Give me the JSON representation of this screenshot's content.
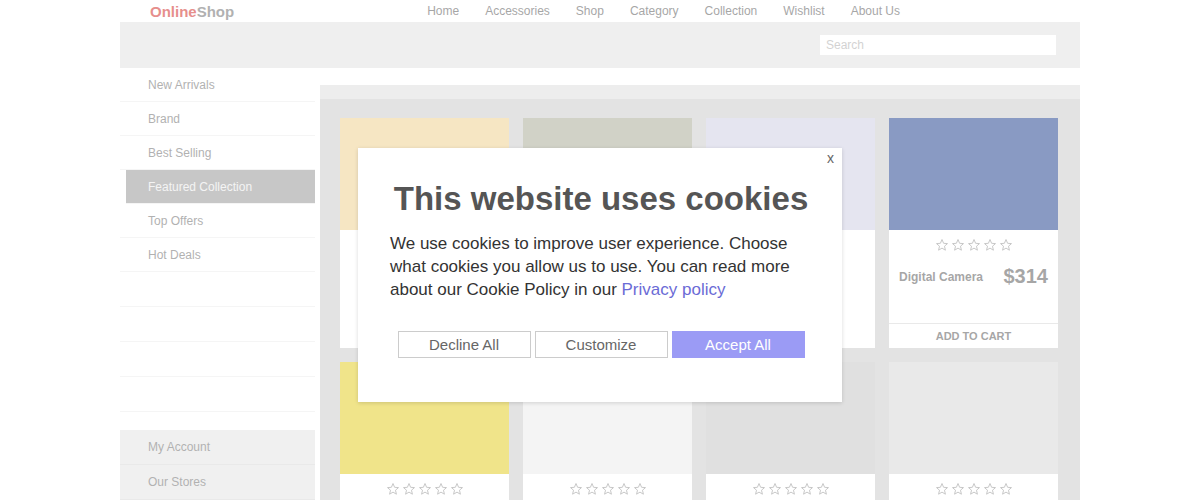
{
  "header": {
    "logo_accent": "Online",
    "logo_rest": "Shop",
    "nav": [
      "Home",
      "Accessories",
      "Shop",
      "Category",
      "Collection",
      "Wishlist",
      "About Us"
    ],
    "search": {
      "placeholder": "Search"
    }
  },
  "sidebar": {
    "items": [
      {
        "label": "New Arrivals",
        "selected": false
      },
      {
        "label": "Brand",
        "selected": false
      },
      {
        "label": "Best Selling",
        "selected": false
      },
      {
        "label": "Featured Collection",
        "selected": true
      },
      {
        "label": "Top Offers",
        "selected": false
      },
      {
        "label": "Hot Deals",
        "selected": false
      }
    ],
    "bottom_items": [
      "My Account",
      "Our Stores"
    ]
  },
  "products": [
    {
      "stars": 0
    },
    {
      "stars": 0
    },
    {
      "stars": 0
    },
    {
      "stars": 0,
      "name": "Digital Camera",
      "price": "$314",
      "button": "ADD TO CART"
    },
    {
      "stars": 0
    },
    {
      "stars": 0
    },
    {
      "stars": 0
    },
    {
      "stars": 0
    }
  ],
  "cookie_dialog": {
    "close": "x",
    "title": "This website uses cookies",
    "message": "We use cookies to improve user experience. Choose what cookies you allow us to use. You can read more about our Cookie Policy in our",
    "link": "Privacy policy",
    "buttons": [
      {
        "label": "Decline All",
        "primary": false
      },
      {
        "label": "Customize",
        "primary": false
      },
      {
        "label": "Accept All",
        "primary": true
      }
    ]
  }
}
